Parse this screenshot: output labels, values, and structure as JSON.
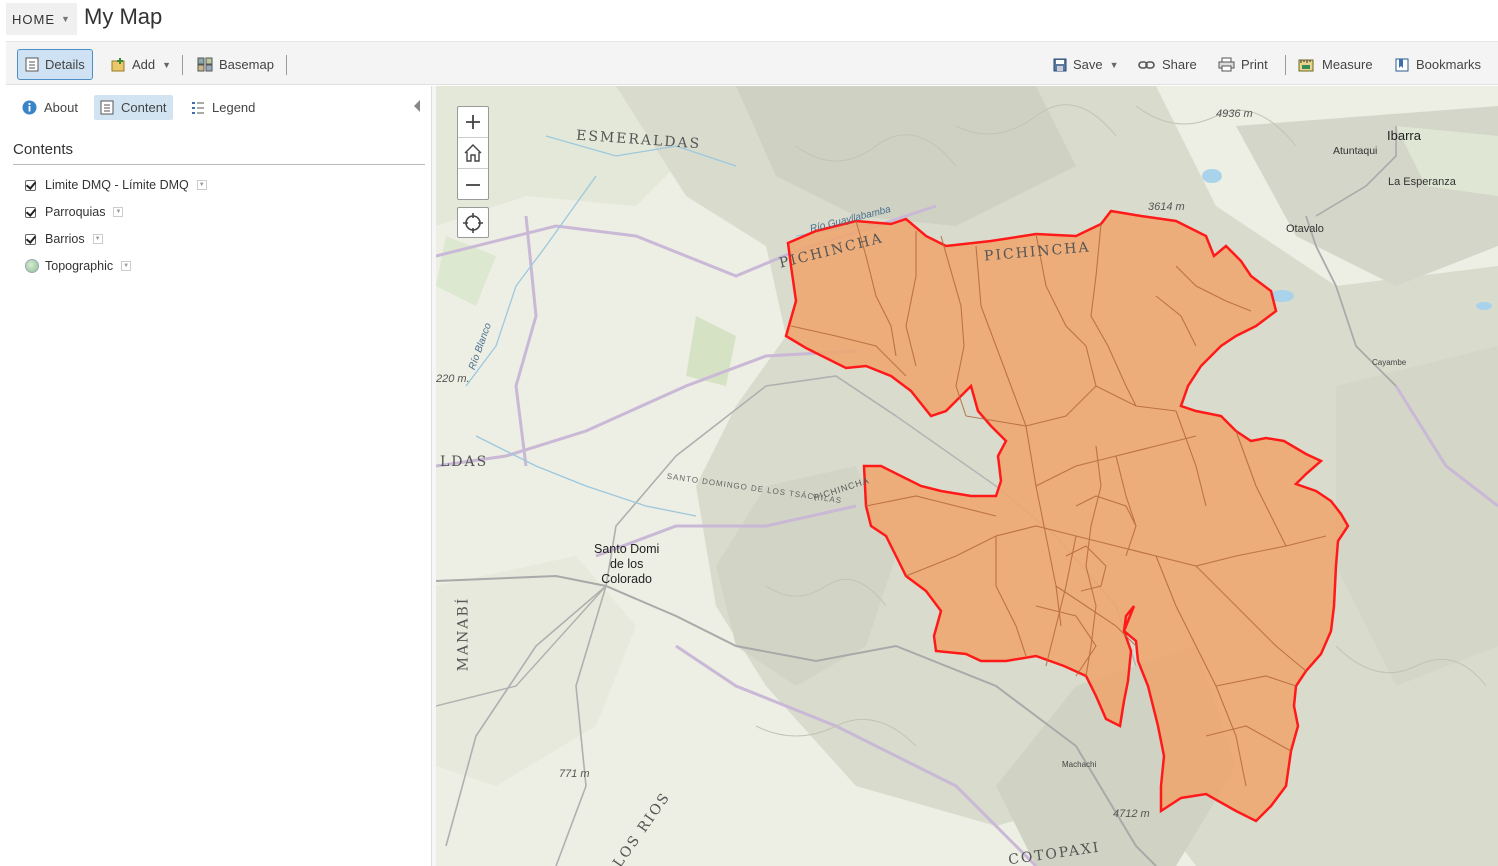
{
  "header": {
    "home_label": "HOME",
    "title": "My Map"
  },
  "toolbar": {
    "details": "Details",
    "add": "Add",
    "basemap": "Basemap",
    "save": "Save",
    "share": "Share",
    "print": "Print",
    "measure": "Measure",
    "bookmarks": "Bookmarks"
  },
  "panel": {
    "tabs": {
      "about": "About",
      "content": "Content",
      "legend": "Legend"
    },
    "contents_title": "Contents",
    "layers": [
      {
        "name": "Limite DMQ - Límite DMQ",
        "checked": true
      },
      {
        "name": "Parroquias",
        "checked": true
      },
      {
        "name": "Barrios",
        "checked": true
      },
      {
        "name": "Topographic",
        "type": "basemap"
      }
    ]
  },
  "map": {
    "labels": {
      "esmeraldas": "ESMERALDAS",
      "pichincha_nw": "PICHINCHA",
      "pichincha_n": "PICHINCHA",
      "pichincha_mid": "PICHINCHA",
      "ldas": "LDAS",
      "manabi": "MANABÍ",
      "los_rios": "LOS RIOS",
      "cotopaxi": "COTOPAXI",
      "ibarra": "Ibarra",
      "atuntaqui": "Atuntaqui",
      "la_esperanza": "La Esperanza",
      "otavalo": "Otavalo",
      "santo_domingo": [
        "Santo Domi",
        "de los",
        "Colorado"
      ],
      "rio_blanco": "Río Blanco",
      "rio_guayllabamba": "Río Guayllabamba",
      "santo_domingo_tsachilas": "SANTO DOMINGO DE LOS TSÁCHILAS",
      "cayambe": "Cayambe",
      "machachi": "Machachi"
    },
    "elevations": {
      "e4936": "4936 m",
      "e3614": "3614 m",
      "e220": "220 m.",
      "e771": "771 m",
      "e4712": "4712 m"
    },
    "colors": {
      "boundary": "#ff1a1a",
      "fill": "#f0a46c",
      "inner_lines": "#b5683a"
    }
  }
}
